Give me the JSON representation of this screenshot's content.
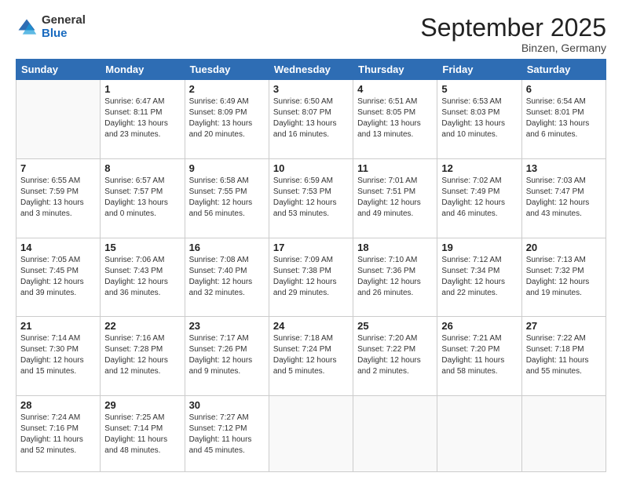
{
  "logo": {
    "general": "General",
    "blue": "Blue"
  },
  "title": "September 2025",
  "subtitle": "Binzen, Germany",
  "days": [
    "Sunday",
    "Monday",
    "Tuesday",
    "Wednesday",
    "Thursday",
    "Friday",
    "Saturday"
  ],
  "weeks": [
    [
      {
        "day": "",
        "info": ""
      },
      {
        "day": "1",
        "info": "Sunrise: 6:47 AM\nSunset: 8:11 PM\nDaylight: 13 hours\nand 23 minutes."
      },
      {
        "day": "2",
        "info": "Sunrise: 6:49 AM\nSunset: 8:09 PM\nDaylight: 13 hours\nand 20 minutes."
      },
      {
        "day": "3",
        "info": "Sunrise: 6:50 AM\nSunset: 8:07 PM\nDaylight: 13 hours\nand 16 minutes."
      },
      {
        "day": "4",
        "info": "Sunrise: 6:51 AM\nSunset: 8:05 PM\nDaylight: 13 hours\nand 13 minutes."
      },
      {
        "day": "5",
        "info": "Sunrise: 6:53 AM\nSunset: 8:03 PM\nDaylight: 13 hours\nand 10 minutes."
      },
      {
        "day": "6",
        "info": "Sunrise: 6:54 AM\nSunset: 8:01 PM\nDaylight: 13 hours\nand 6 minutes."
      }
    ],
    [
      {
        "day": "7",
        "info": "Sunrise: 6:55 AM\nSunset: 7:59 PM\nDaylight: 13 hours\nand 3 minutes."
      },
      {
        "day": "8",
        "info": "Sunrise: 6:57 AM\nSunset: 7:57 PM\nDaylight: 13 hours\nand 0 minutes."
      },
      {
        "day": "9",
        "info": "Sunrise: 6:58 AM\nSunset: 7:55 PM\nDaylight: 12 hours\nand 56 minutes."
      },
      {
        "day": "10",
        "info": "Sunrise: 6:59 AM\nSunset: 7:53 PM\nDaylight: 12 hours\nand 53 minutes."
      },
      {
        "day": "11",
        "info": "Sunrise: 7:01 AM\nSunset: 7:51 PM\nDaylight: 12 hours\nand 49 minutes."
      },
      {
        "day": "12",
        "info": "Sunrise: 7:02 AM\nSunset: 7:49 PM\nDaylight: 12 hours\nand 46 minutes."
      },
      {
        "day": "13",
        "info": "Sunrise: 7:03 AM\nSunset: 7:47 PM\nDaylight: 12 hours\nand 43 minutes."
      }
    ],
    [
      {
        "day": "14",
        "info": "Sunrise: 7:05 AM\nSunset: 7:45 PM\nDaylight: 12 hours\nand 39 minutes."
      },
      {
        "day": "15",
        "info": "Sunrise: 7:06 AM\nSunset: 7:43 PM\nDaylight: 12 hours\nand 36 minutes."
      },
      {
        "day": "16",
        "info": "Sunrise: 7:08 AM\nSunset: 7:40 PM\nDaylight: 12 hours\nand 32 minutes."
      },
      {
        "day": "17",
        "info": "Sunrise: 7:09 AM\nSunset: 7:38 PM\nDaylight: 12 hours\nand 29 minutes."
      },
      {
        "day": "18",
        "info": "Sunrise: 7:10 AM\nSunset: 7:36 PM\nDaylight: 12 hours\nand 26 minutes."
      },
      {
        "day": "19",
        "info": "Sunrise: 7:12 AM\nSunset: 7:34 PM\nDaylight: 12 hours\nand 22 minutes."
      },
      {
        "day": "20",
        "info": "Sunrise: 7:13 AM\nSunset: 7:32 PM\nDaylight: 12 hours\nand 19 minutes."
      }
    ],
    [
      {
        "day": "21",
        "info": "Sunrise: 7:14 AM\nSunset: 7:30 PM\nDaylight: 12 hours\nand 15 minutes."
      },
      {
        "day": "22",
        "info": "Sunrise: 7:16 AM\nSunset: 7:28 PM\nDaylight: 12 hours\nand 12 minutes."
      },
      {
        "day": "23",
        "info": "Sunrise: 7:17 AM\nSunset: 7:26 PM\nDaylight: 12 hours\nand 9 minutes."
      },
      {
        "day": "24",
        "info": "Sunrise: 7:18 AM\nSunset: 7:24 PM\nDaylight: 12 hours\nand 5 minutes."
      },
      {
        "day": "25",
        "info": "Sunrise: 7:20 AM\nSunset: 7:22 PM\nDaylight: 12 hours\nand 2 minutes."
      },
      {
        "day": "26",
        "info": "Sunrise: 7:21 AM\nSunset: 7:20 PM\nDaylight: 11 hours\nand 58 minutes."
      },
      {
        "day": "27",
        "info": "Sunrise: 7:22 AM\nSunset: 7:18 PM\nDaylight: 11 hours\nand 55 minutes."
      }
    ],
    [
      {
        "day": "28",
        "info": "Sunrise: 7:24 AM\nSunset: 7:16 PM\nDaylight: 11 hours\nand 52 minutes."
      },
      {
        "day": "29",
        "info": "Sunrise: 7:25 AM\nSunset: 7:14 PM\nDaylight: 11 hours\nand 48 minutes."
      },
      {
        "day": "30",
        "info": "Sunrise: 7:27 AM\nSunset: 7:12 PM\nDaylight: 11 hours\nand 45 minutes."
      },
      {
        "day": "",
        "info": ""
      },
      {
        "day": "",
        "info": ""
      },
      {
        "day": "",
        "info": ""
      },
      {
        "day": "",
        "info": ""
      }
    ]
  ]
}
